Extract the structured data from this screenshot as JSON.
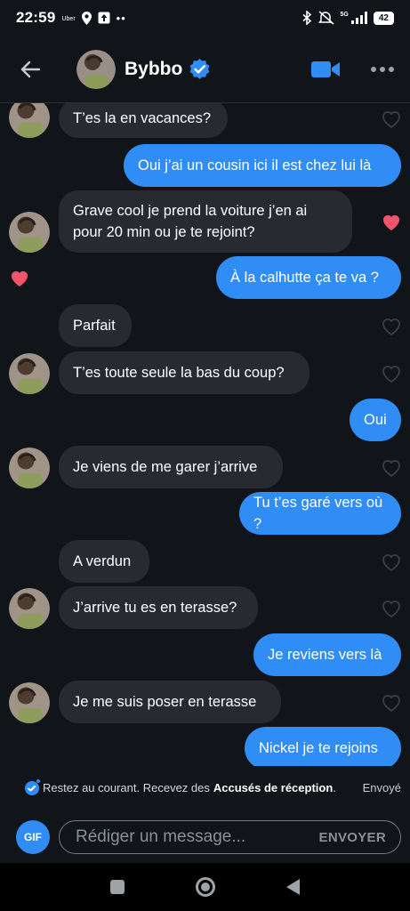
{
  "status_bar": {
    "time": "22:59",
    "uber_label": "Uber",
    "network": "5G",
    "battery": "42"
  },
  "header": {
    "contact_name": "Bybbo",
    "verified": true
  },
  "messages": [
    {
      "dir": "in",
      "text": "T’es la en vacances?",
      "avatar": true,
      "heart": "right-outline"
    },
    {
      "dir": "out",
      "text": "Oui j’ai un cousin ici il est chez lui là"
    },
    {
      "dir": "in",
      "text": "Grave cool je prend la voiture j’en ai pour 20 min ou je te rejoint?",
      "avatar": true,
      "heart": "right-filled"
    },
    {
      "dir": "out",
      "text": "À la calhutte ça te va ?",
      "heart": "left-filled"
    },
    {
      "dir": "in",
      "text": "Parfait",
      "heart": "right-outline"
    },
    {
      "dir": "in",
      "text": "T’es toute seule la bas du coup?",
      "avatar": true,
      "heart": "right-outline"
    },
    {
      "dir": "out",
      "text": "Oui"
    },
    {
      "dir": "in",
      "text": "Je viens de me garer j’arrive",
      "avatar": true,
      "heart": "right-outline"
    },
    {
      "dir": "out",
      "text": "Tu t’es garé vers où ?"
    },
    {
      "dir": "in",
      "text": "A verdun",
      "heart": "right-outline"
    },
    {
      "dir": "in",
      "text": "J’arrive tu es en terasse?",
      "avatar": true,
      "heart": "right-outline"
    },
    {
      "dir": "out",
      "text": "Je reviens vers là"
    },
    {
      "dir": "in",
      "text": "Je me suis poser en terasse",
      "avatar": true,
      "heart": "right-outline"
    },
    {
      "dir": "out",
      "text": "Nickel je te rejoins"
    }
  ],
  "receipt": {
    "text": "Restez au courant. Recevez des",
    "strong": "Accusés de réception",
    "end": ".",
    "sent": "Envoyé"
  },
  "compose": {
    "gif_label": "GIF",
    "placeholder": "Rédiger un message...",
    "send_label": "ENVOYER"
  },
  "colors": {
    "accent": "#2f8df5",
    "incoming_bubble": "#272a31",
    "heart_filled": "#f2546a",
    "background": "#111418"
  }
}
